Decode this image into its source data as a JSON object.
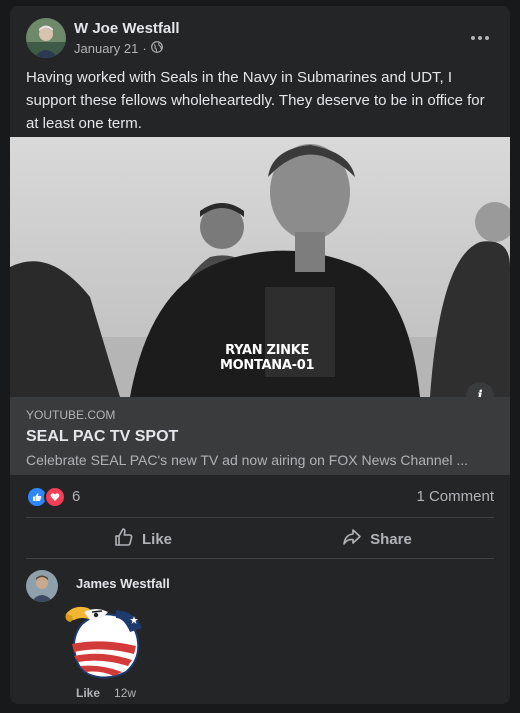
{
  "post": {
    "author": "W Joe Westfall",
    "date": "January 21",
    "separator": "·",
    "text": "Having worked with Seals in the Navy in Submarines and UDT, I support these fellows wholeheartedly. They deserve to be in office for at least one term.",
    "media_overlay_line1": "RYAN ZINKE",
    "media_overlay_line2": "MONTANA-01",
    "link": {
      "domain": "YOUTUBE.COM",
      "title": "SEAL PAC TV SPOT",
      "description": "Celebrate SEAL PAC's new TV ad now airing on FOX News Channel ..."
    },
    "reactions": {
      "count": "6",
      "types": [
        "like-icon",
        "love-icon"
      ]
    },
    "comments_label": "1 Comment",
    "actions": {
      "like": "Like",
      "share": "Share"
    }
  },
  "comment": {
    "author": "James Westfall",
    "like": "Like",
    "time": "12w"
  },
  "colors": {
    "background": "#18191a",
    "card": "#242526",
    "like_blue": "#2d88ff",
    "love_red": "#f33e58"
  }
}
